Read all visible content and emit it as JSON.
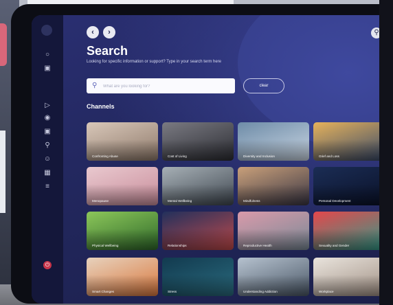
{
  "page": {
    "title": "Search",
    "subtitle": "Looking for specific information or support? Type in your search term here"
  },
  "search": {
    "placeholder": "What are you looking for?",
    "clear_label": "clear"
  },
  "section": {
    "channels_heading": "Channels"
  },
  "channels": [
    {
      "label": "Confronting Abuse",
      "colors": [
        "#d8c7b9",
        "#8f7a6b"
      ]
    },
    {
      "label": "Cost of Living",
      "colors": [
        "#7a7a82",
        "#2c2d33"
      ]
    },
    {
      "label": "Diversity and Inclusion",
      "colors": [
        "#6e8ca8",
        "#c9d5e2"
      ]
    },
    {
      "label": "Grief and Loss",
      "colors": [
        "#e6b25b",
        "#37496a"
      ]
    },
    {
      "label": "Menopause",
      "colors": [
        "#e9c9cf",
        "#c88c9a"
      ]
    },
    {
      "label": "Mental Wellbeing",
      "colors": [
        "#a7b0b6",
        "#3f4750"
      ]
    },
    {
      "label": "Mindfulness",
      "colors": [
        "#c9a07a",
        "#3a3644"
      ]
    },
    {
      "label": "Personal Development",
      "colors": [
        "#1b2d55",
        "#0a1128"
      ]
    },
    {
      "label": "Physical Wellbeing",
      "colors": [
        "#8cc65a",
        "#2f6a2a"
      ]
    },
    {
      "label": "Relationships",
      "colors": [
        "#22305c",
        "#c14a4a"
      ]
    },
    {
      "label": "Reproductive Health",
      "colors": [
        "#d99aaa",
        "#7a8a97"
      ]
    },
    {
      "label": "Sexuality and Gender",
      "colors": [
        "#e5474b",
        "#2f9c8a"
      ]
    },
    {
      "label": "Smart Changes",
      "colors": [
        "#e7d2bd",
        "#d9783e"
      ]
    },
    {
      "label": "Stress",
      "colors": [
        "#123a4f",
        "#2a6b7e"
      ]
    },
    {
      "label": "Understanding Addiction",
      "colors": [
        "#b6c2cf",
        "#4a5766"
      ]
    },
    {
      "label": "Workplace",
      "colors": [
        "#e9e4dd",
        "#a08f83"
      ]
    }
  ],
  "sidebar": {
    "icons": [
      "user-icon",
      "book-icon",
      "play-icon",
      "location-icon",
      "cart-icon",
      "search-icon",
      "person-icon",
      "calendar-icon",
      "list-icon"
    ],
    "logout_icon": "power-icon"
  },
  "topbar": {
    "back_icon": "chevron-left-icon",
    "forward_icon": "chevron-right-icon",
    "search_icon": "search-icon",
    "profile_icon": "avatar-icon"
  }
}
